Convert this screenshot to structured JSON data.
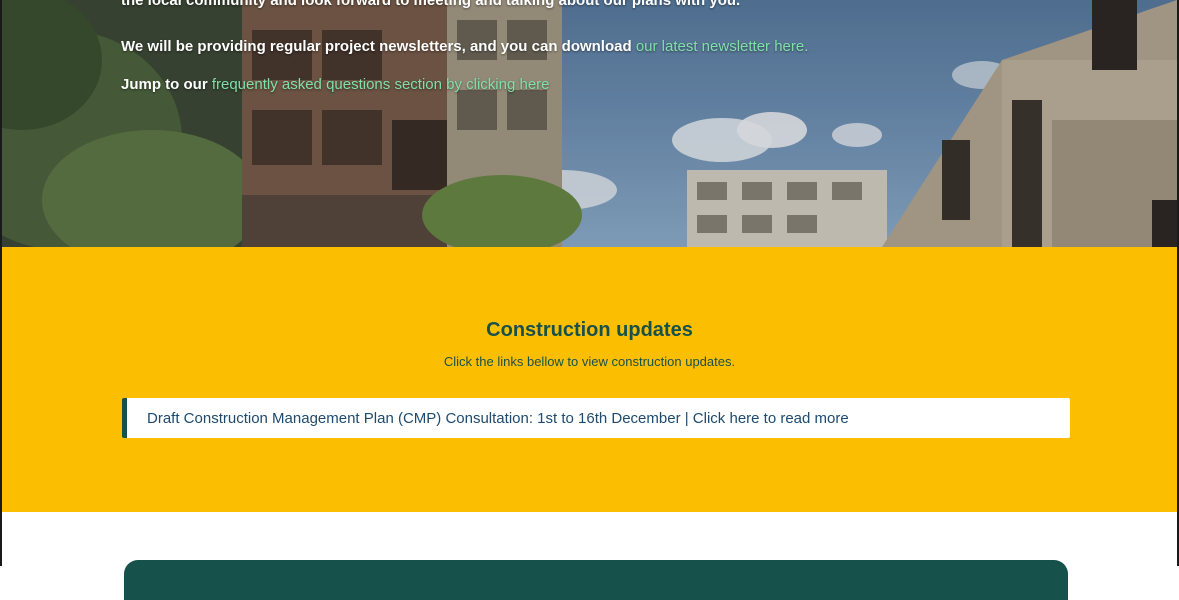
{
  "hero": {
    "line1_text": "the local community and look forward to meeting and talking about our plans with you.",
    "line2_text": "We will be providing regular project newsletters, and you can download ",
    "line2_link": "our latest newsletter here.",
    "line3_text": "Jump to our ",
    "line3_link": "frequently asked questions section by clicking here"
  },
  "updates": {
    "title": "Construction updates",
    "subtitle": "Click the links bellow to view construction updates.",
    "items": [
      {
        "label": "Draft Construction Management Plan (CMP) Consultation: 1st to 16th December | Click here to read more"
      }
    ]
  },
  "colors": {
    "accent_yellow": "#fcbe00",
    "brand_green": "#17514c",
    "link_green": "#7fe0a8",
    "link_blue": "#1d4a6e"
  }
}
